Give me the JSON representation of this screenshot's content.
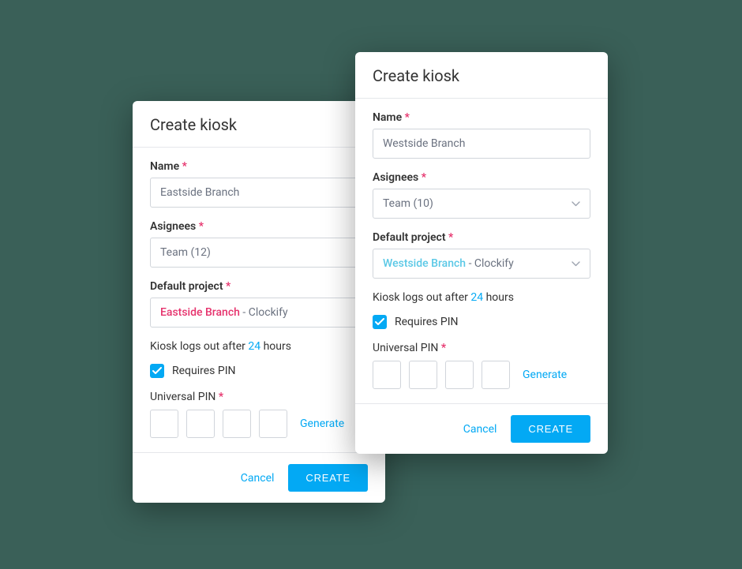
{
  "dialog_back": {
    "title": "Create kiosk",
    "name_label": "Name",
    "name_value": "Eastside Branch",
    "assignees_label": "Asignees",
    "assignees_value": "Team (12)",
    "project_label": "Default project",
    "project_name": "Eastside Branch",
    "project_client": " - Clockify",
    "logout_prefix": "Kiosk logs out after ",
    "logout_hours": "24",
    "logout_suffix": " hours",
    "requires_pin_label": "Requires PIN",
    "universal_pin_label": "Universal PIN",
    "generate_label": "Generate",
    "cancel_label": "Cancel",
    "create_label": "CREATE",
    "required_mark": "*"
  },
  "dialog_front": {
    "title": "Create kiosk",
    "name_label": "Name",
    "name_value": "Westside Branch",
    "assignees_label": "Asignees",
    "assignees_value": "Team (10)",
    "project_label": "Default project",
    "project_name": "Westside Branch",
    "project_client": " - Clockify",
    "logout_prefix": "Kiosk logs out after ",
    "logout_hours": "24",
    "logout_suffix": " hours",
    "requires_pin_label": "Requires PIN",
    "universal_pin_label": "Universal PIN",
    "generate_label": "Generate",
    "cancel_label": "Cancel",
    "create_label": "CREATE",
    "required_mark": "*"
  }
}
